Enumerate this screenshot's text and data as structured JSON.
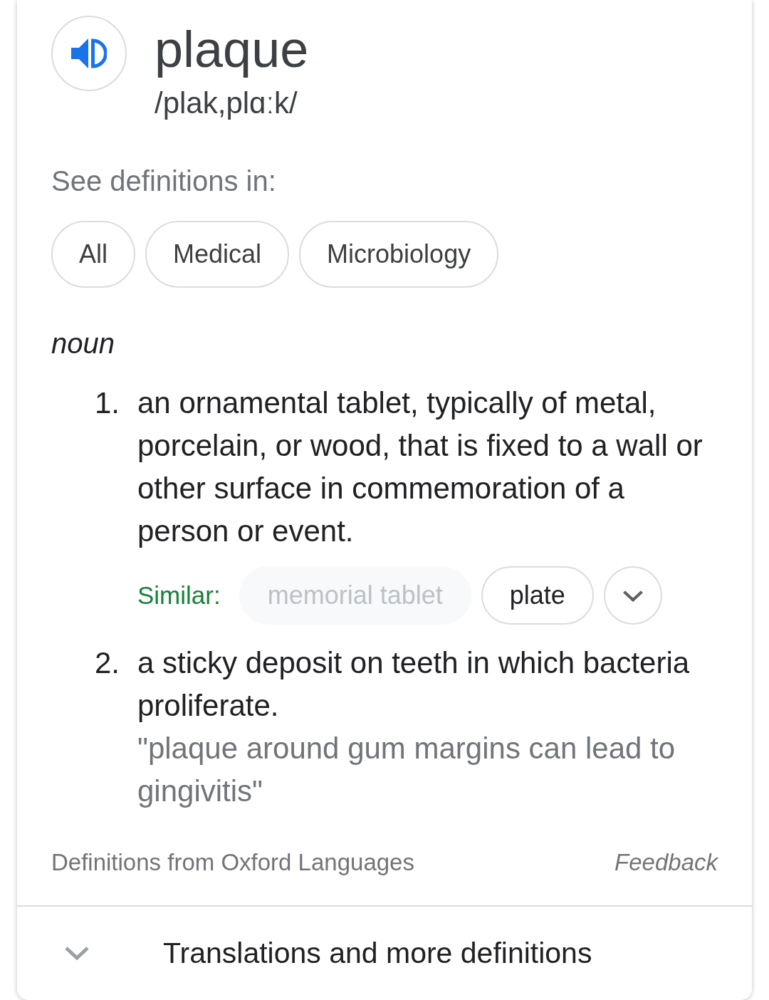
{
  "entry": {
    "word": "plaque",
    "phonetic": "/plak,plɑːk/"
  },
  "sources": {
    "label": "See definitions in:",
    "chips": [
      {
        "label": "All",
        "selected": false
      },
      {
        "label": "Medical",
        "selected": false
      },
      {
        "label": "Microbiology",
        "selected": false
      }
    ]
  },
  "part_of_speech": "noun",
  "definitions": [
    {
      "number": "1.",
      "text": "an ornamental tablet, typically of metal, porcelain, or wood, that is fixed to a wall or other surface in commemoration of a person or event.",
      "similar": {
        "label": "Similar:",
        "terms": [
          {
            "label": "memorial tablet",
            "disabled": true
          },
          {
            "label": "plate",
            "disabled": false
          }
        ]
      }
    },
    {
      "number": "2.",
      "text": "a sticky deposit on teeth in which bacteria proliferate.",
      "example": "\"plaque around gum margins can lead to gingivitis\""
    }
  ],
  "footer": {
    "source": "Definitions from Oxford Languages",
    "feedback": "Feedback"
  },
  "more": {
    "label": "Translations and more definitions",
    "expanded": false
  }
}
